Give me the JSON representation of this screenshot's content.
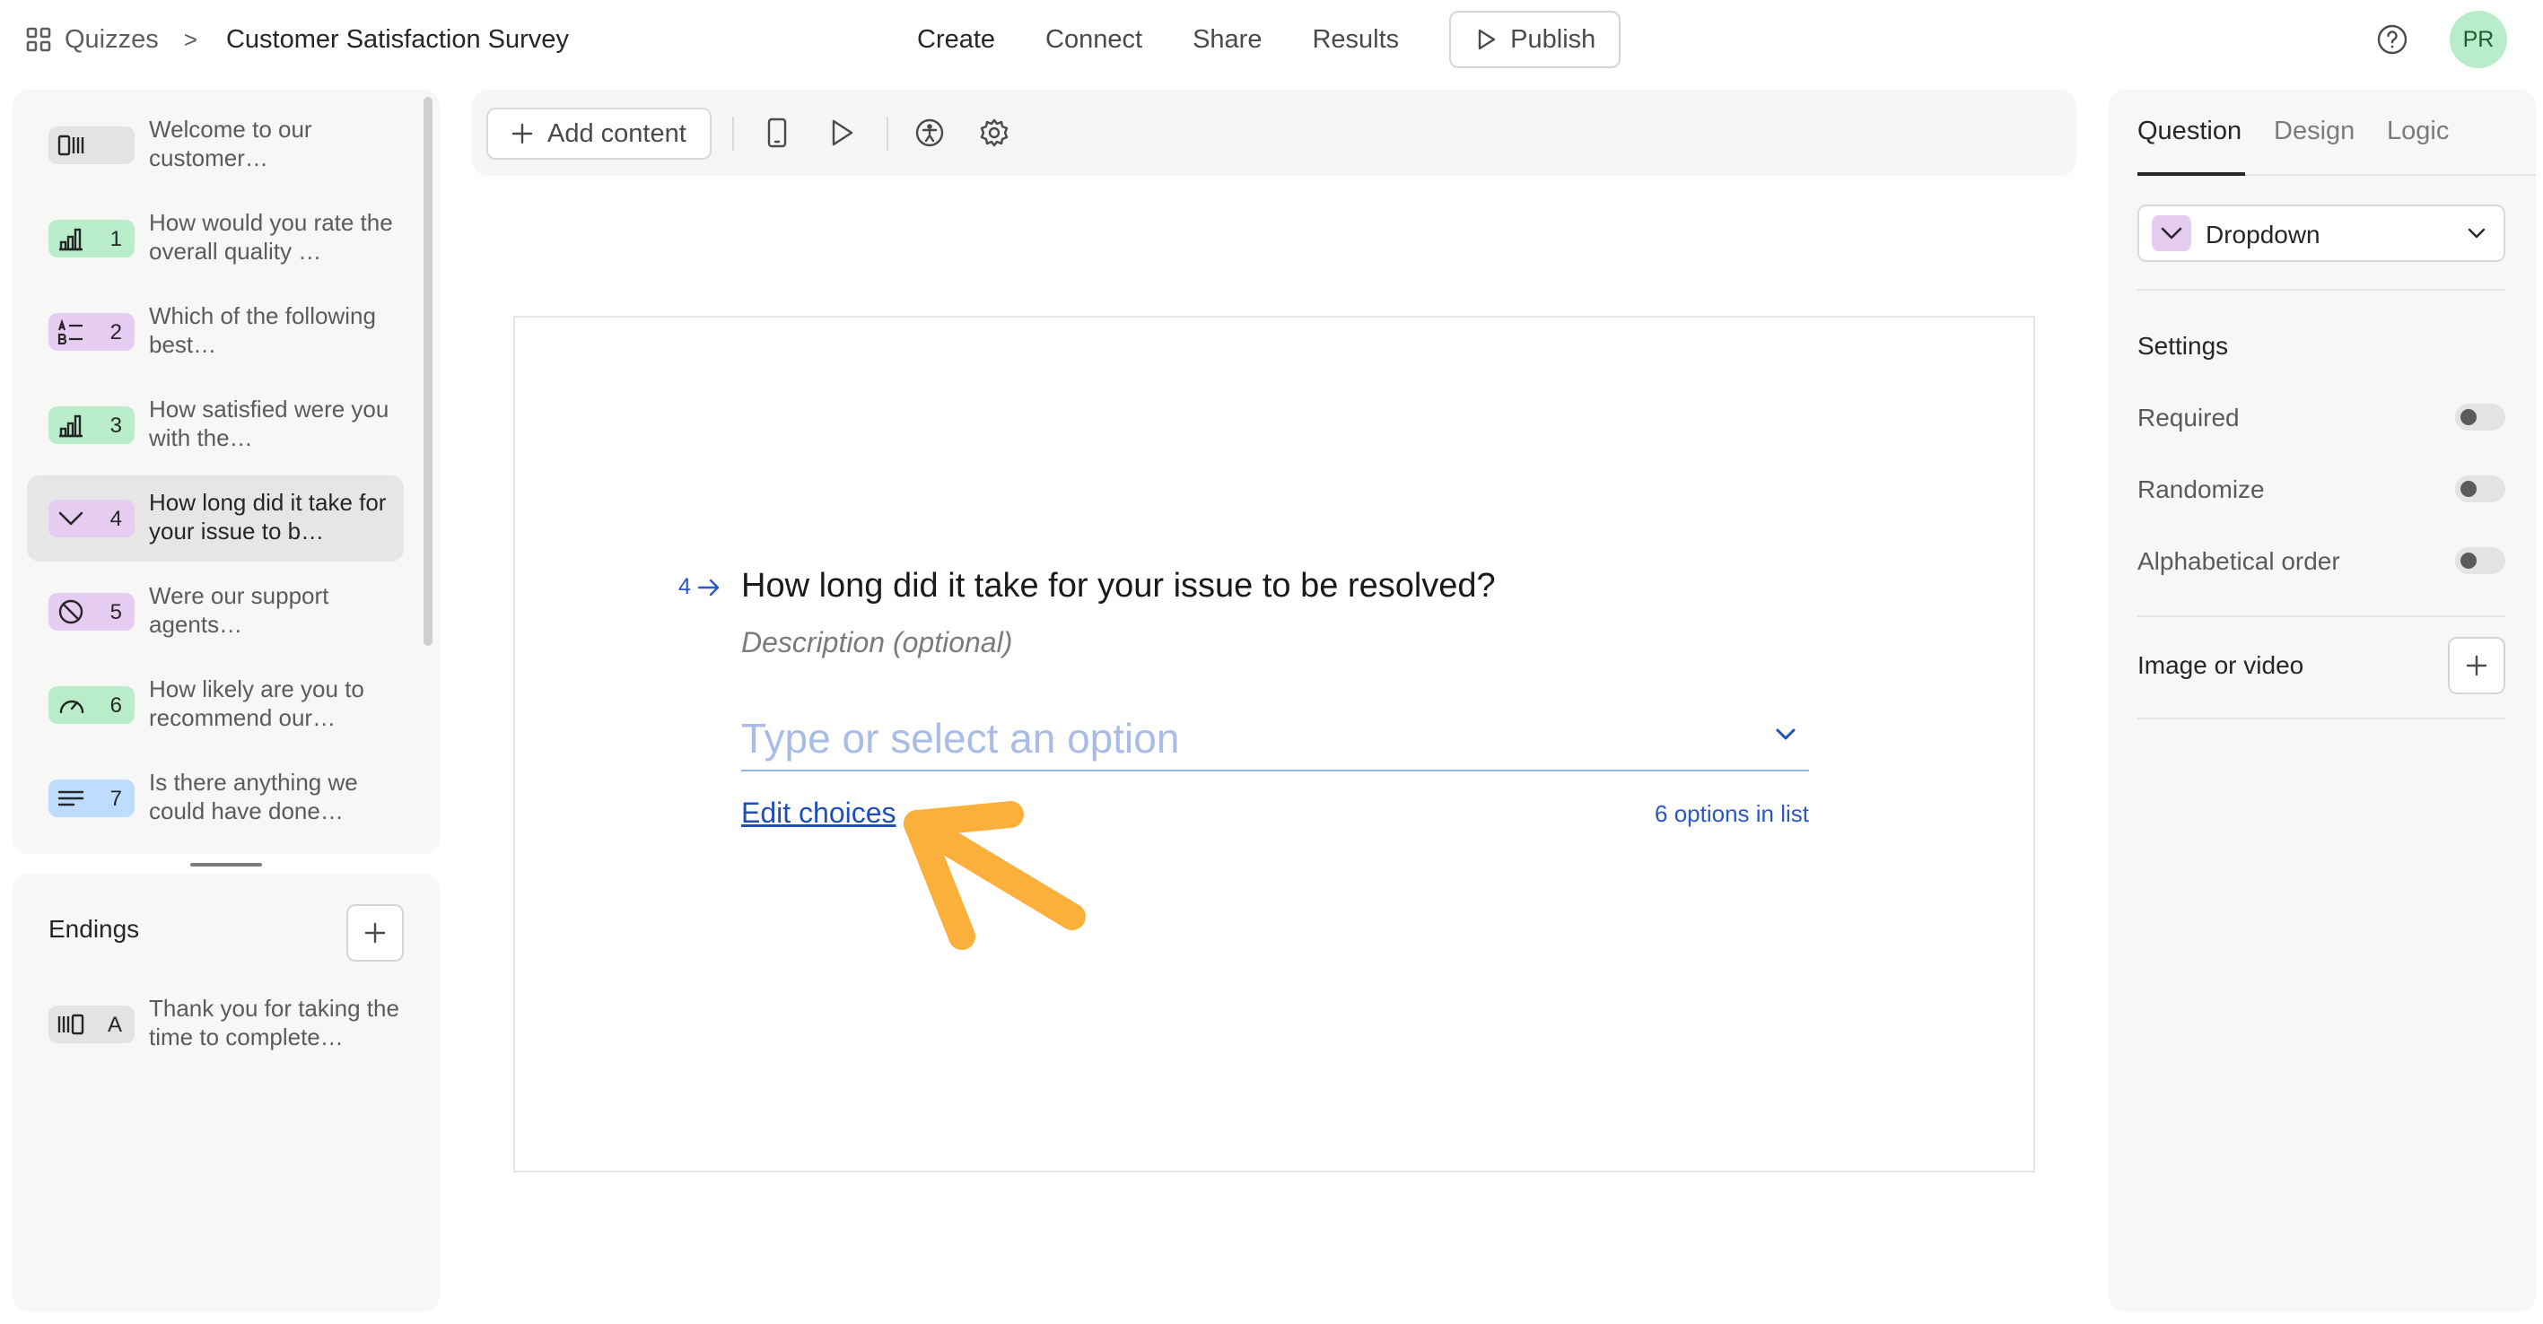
{
  "header": {
    "breadcrumb_root": "Quizzes",
    "breadcrumb_sep": ">",
    "form_title": "Customer Satisfaction Survey",
    "nav": [
      "Create",
      "Connect",
      "Share",
      "Results"
    ],
    "publish_label": "Publish",
    "avatar_initials": "PR"
  },
  "questions": [
    {
      "num": "",
      "text": "Welcome to our customer…",
      "icon": "welcome-icon",
      "color": "gray"
    },
    {
      "num": "1",
      "text": "How would you rate the overall quality …",
      "icon": "rating-chart-icon",
      "color": "green"
    },
    {
      "num": "2",
      "text": "Which of the following best…",
      "icon": "multiple-choice-icon",
      "color": "purple"
    },
    {
      "num": "3",
      "text": "How satisfied were you with the…",
      "icon": "rating-chart-icon",
      "color": "green"
    },
    {
      "num": "4",
      "text": "How long did it take for your issue to b…",
      "icon": "chevron-down-icon",
      "color": "purple"
    },
    {
      "num": "5",
      "text": "Were our support agents…",
      "icon": "yes-no-icon",
      "color": "purple"
    },
    {
      "num": "6",
      "text": "How likely are you to recommend our…",
      "icon": "gauge-icon",
      "color": "green"
    },
    {
      "num": "7",
      "text": "Is there anything we could have done…",
      "icon": "long-text-icon",
      "color": "blue"
    }
  ],
  "endings": {
    "title": "Endings",
    "items": [
      {
        "letter": "A",
        "text": "Thank you for taking the time to complete…",
        "icon": "ending-icon"
      }
    ]
  },
  "toolbar": {
    "add_content_label": "Add content"
  },
  "editor": {
    "question_number": "4",
    "question_title": "How long did it take for your issue to be resolved?",
    "description_placeholder": "Description (optional)",
    "dropdown_placeholder": "Type or select an option",
    "edit_choices_label": "Edit choices",
    "options_count_label": "6 options in list"
  },
  "right_panel": {
    "tabs": [
      "Question",
      "Design",
      "Logic"
    ],
    "question_type": "Dropdown",
    "settings_title": "Settings",
    "settings": [
      {
        "label": "Required",
        "on": false
      },
      {
        "label": "Randomize",
        "on": false
      },
      {
        "label": "Alphabetical order",
        "on": false
      }
    ],
    "image_video_label": "Image or video"
  },
  "colors": {
    "accent_blue": "#2a58c4",
    "annotation_arrow": "#fbb03b",
    "badge_green": "#b9ecc9",
    "badge_purple": "#e7ccf2",
    "badge_blue": "#bddcff",
    "badge_gray": "#e3e3e3"
  }
}
